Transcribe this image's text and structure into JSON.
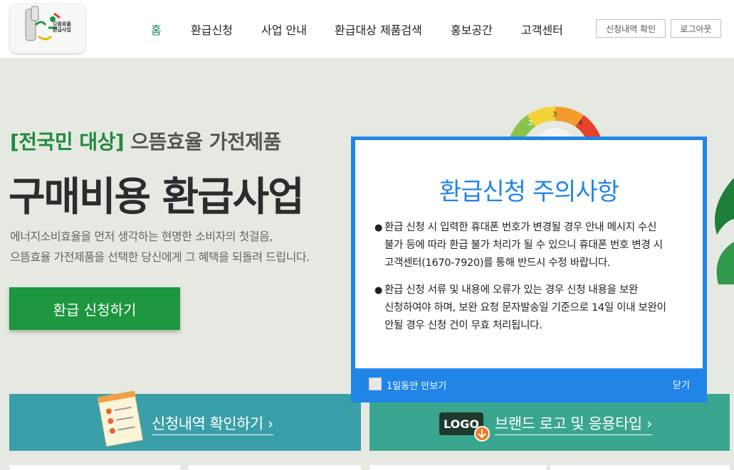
{
  "header": {
    "logo_line1": "으뜸효율",
    "logo_line2": "환급사업",
    "nav": [
      {
        "label": "홈",
        "active": true
      },
      {
        "label": "환급신청",
        "active": false
      },
      {
        "label": "사업 안내",
        "active": false
      },
      {
        "label": "환급대상 제품검색",
        "active": false
      },
      {
        "label": "홍보공간",
        "active": false
      },
      {
        "label": "고객센터",
        "active": false
      }
    ],
    "check_button": "신청내역 확인",
    "logout_button": "로그아웃"
  },
  "hero": {
    "sub_accent": "[전국민 대상]",
    "sub_rest": "으뜸효율 가전제품",
    "title": "구매비용 환급사업",
    "desc_line1": "에너지소비효율을 먼저 생각하는 현명한 소비자의 첫걸음,",
    "desc_line2": "으뜸효율 가전제품을 선택한 당신에게 그 혜택을 되돌려 드립니다.",
    "apply_button": "환급 신청하기"
  },
  "gauge": {
    "segments": [
      "2",
      "3",
      "4"
    ],
    "colors": [
      "#8bc34a",
      "#f2d43a",
      "#f39c2c",
      "#e8412c"
    ]
  },
  "cards": {
    "check": "신청내역 확인하기 ›",
    "logo_badge": "LOGO",
    "brand": "브랜드 로고 및 응용타입 ›"
  },
  "modal": {
    "title": "환급신청 주의사항",
    "item1_line1": "환급 신청 시 입력한 휴대폰 번호가 변경될 경우 안내 메시지 수신",
    "item1_line2": "불가 등에 따라 환급 불가 처리가 될 수 있으니 휴대폰 번호 변경 시",
    "item1_line3": "고객센터(1670-7920)를 통해 반드시 수정 바랍니다.",
    "item2_line1": "환급 신청 서류 및 내용에 오류가 있는 경우 신청 내용을 보완",
    "item2_line2": "신청하여야 하며, 보완 요청 문자발송일 기준으로 14일 이내 보완이",
    "item2_line3": "안될 경우 신청 건이 무효 처리됩니다.",
    "bullet": "●",
    "dont_show_label": "1일동안 안보기",
    "close_label": "닫기"
  },
  "colors": {
    "brand_green": "#1e9640",
    "modal_blue": "#2185e8",
    "card_teal": "#3a9fa8",
    "card_green": "#3aa690"
  }
}
